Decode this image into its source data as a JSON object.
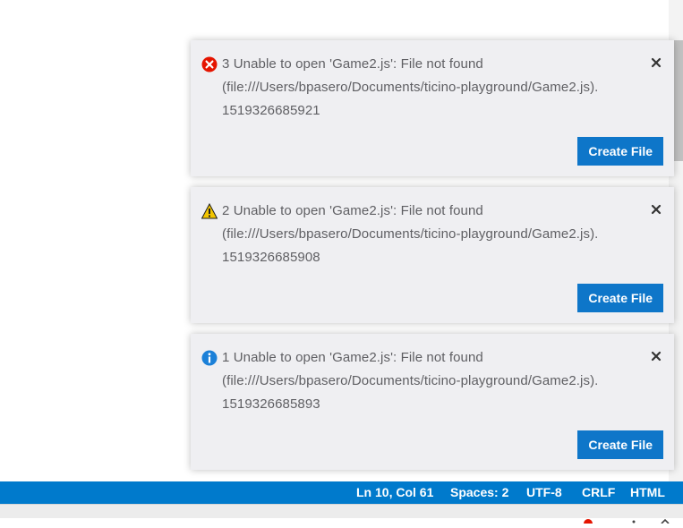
{
  "colors": {
    "accent": "#007acc",
    "button": "#0e76c9",
    "error": "#e51400",
    "warning": "#f2c500",
    "info": "#1b80d8"
  },
  "notifications": [
    {
      "severity": "error",
      "icon": "error-icon",
      "message_line1": "3 Unable to open 'Game2.js': File not found",
      "message_line2": "(file:///Users/bpasero/Documents/ticino-playground/Game2.js).",
      "message_line3": "1519326685921",
      "action_label": "Create File"
    },
    {
      "severity": "warning",
      "icon": "warning-icon",
      "message_line1": "2 Unable to open 'Game2.js': File not found",
      "message_line2": "(file:///Users/bpasero/Documents/ticino-playground/Game2.js).",
      "message_line3": "1519326685908",
      "action_label": "Create File"
    },
    {
      "severity": "info",
      "icon": "info-icon",
      "message_line1": "1 Unable to open 'Game2.js': File not found",
      "message_line2": "(file:///Users/bpasero/Documents/ticino-playground/Game2.js).",
      "message_line3": "1519326685893",
      "action_label": "Create File"
    }
  ],
  "status_bar": {
    "position": "Ln 10, Col 61",
    "spaces": "Spaces: 2",
    "encoding": "UTF-8",
    "line_ending": "CRLF",
    "language": "HTML"
  }
}
